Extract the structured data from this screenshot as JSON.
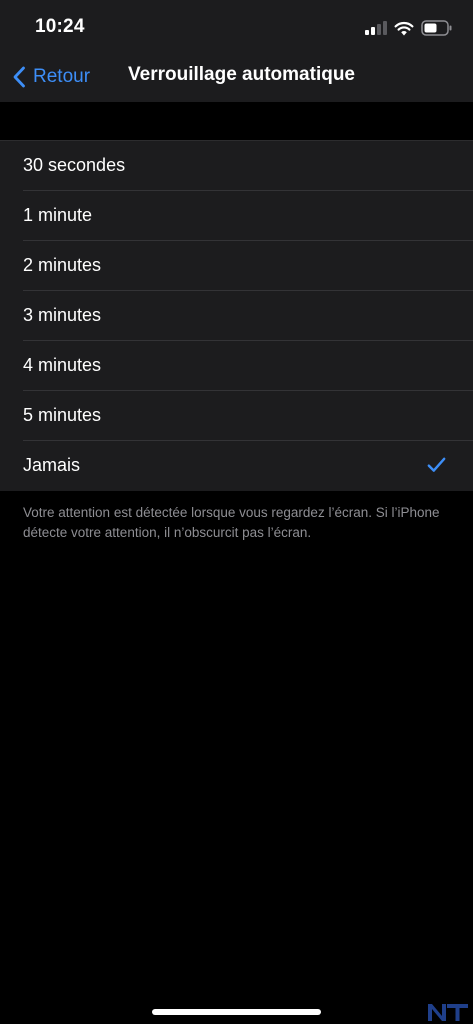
{
  "status_bar": {
    "time": "10:24"
  },
  "nav": {
    "back_label": "Retour",
    "title": "Verrouillage automatique"
  },
  "options": [
    {
      "label": "30 secondes",
      "selected": false
    },
    {
      "label": "1 minute",
      "selected": false
    },
    {
      "label": "2 minutes",
      "selected": false
    },
    {
      "label": "3 minutes",
      "selected": false
    },
    {
      "label": "4 minutes",
      "selected": false
    },
    {
      "label": "5 minutes",
      "selected": false
    },
    {
      "label": "Jamais",
      "selected": true
    }
  ],
  "footer_note": "Votre attention est détectée lorsque vous regardez l’écran. Si l’iPhone détecte votre attention, il n’obscurcit pas l’écran.",
  "watermark": {
    "text": "NT"
  },
  "colors": {
    "accent": "#3d8ef7",
    "background": "#000000",
    "grouped_background": "#1c1c1e",
    "secondary_text": "#8e8e93"
  },
  "icons": {
    "back": "chevron-left-icon",
    "check": "checkmark-icon",
    "signal": "cellular-signal-icon",
    "wifi": "wifi-icon",
    "battery": "battery-icon"
  }
}
